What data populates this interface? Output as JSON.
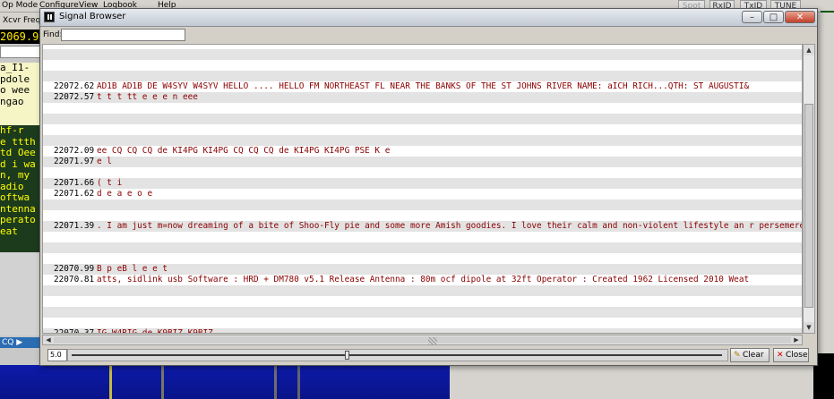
{
  "background": {
    "menus": [
      "Op Mode",
      "Configure",
      "View",
      "Logbook",
      "Help"
    ],
    "right_buttons": [
      "Spot",
      "RxID",
      "TxID",
      "TUNE"
    ],
    "xcvr_freq_label": "Xcvr Freq",
    "freq_display": "2069.9",
    "rx_text": [
      "a_I1-",
      " pdole",
      "o wee",
      " ngao",
      "",
      "hf-r",
      "e ttth",
      "td Oee",
      "d i wa",
      "n, my",
      "adio",
      "oftwa",
      "ntenna",
      "perato",
      "eat"
    ],
    "cq_label": "CQ ▶"
  },
  "window": {
    "title": "Signal Browser",
    "controls": [
      "–",
      "□",
      "✕"
    ]
  },
  "find": {
    "label": "Find:",
    "value": ""
  },
  "rows": [
    {
      "freq": "",
      "text": "",
      "shade": true
    },
    {
      "freq": "",
      "text": "",
      "shade": false
    },
    {
      "freq": "",
      "text": "",
      "shade": true
    },
    {
      "freq": "22072.62",
      "text": "AD1B AD1B DE W4SYV W4SYV HELLO ....  HELLO FM NORTHEAST FL NEAR THE BANKS OF  THE ST JOHNS RIVER  NAME: aICH RICH...QTH: ST AUGUSTI&",
      "shade": false
    },
    {
      "freq": "22072.57",
      "text": "t   t      t      tt e  e    e  n  eee",
      "shade": true
    },
    {
      "freq": "",
      "text": "",
      "shade": false
    },
    {
      "freq": "",
      "text": "",
      "shade": true
    },
    {
      "freq": "",
      "text": "",
      "shade": false
    },
    {
      "freq": "",
      "text": "",
      "shade": true
    },
    {
      "freq": "22072.09",
      "text": "ee CQ CQ CQ de KI4PG KI4PG CQ CQ CQ de KI4PG KI4PG PSE K  e",
      "shade": false
    },
    {
      "freq": "22071.97",
      "text": "e l",
      "shade": true
    },
    {
      "freq": "",
      "text": "",
      "shade": false
    },
    {
      "freq": "22071.66",
      "text": "( t i",
      "shade": true
    },
    {
      "freq": "22071.62",
      "text": "d e    a    e o e",
      "shade": false
    },
    {
      "freq": "",
      "text": "",
      "shade": true
    },
    {
      "freq": "",
      "text": "",
      "shade": false
    },
    {
      "freq": "22071.39",
      "text": ". I am just m=now dreaming of a bite of Shoo-Fly pie and some more Amish goodies. I love their calm and non-violent lifestyle an r persemere",
      "shade": true
    },
    {
      "freq": "",
      "text": "",
      "shade": false
    },
    {
      "freq": "",
      "text": "",
      "shade": true
    },
    {
      "freq": "",
      "text": "",
      "shade": false
    },
    {
      "freq": "22070.99",
      "text": "B p  eB   l e          e       t",
      "shade": true
    },
    {
      "freq": "22070.81",
      "text": "atts, sidlink usb    Software : HRD + DM780 v5.1 Release   Antenna  : 80m ocf dipole at 32ft   Operator : Created 1962  Licensed 2010   Weat",
      "shade": false
    },
    {
      "freq": "",
      "text": "",
      "shade": true
    },
    {
      "freq": "",
      "text": "",
      "shade": false
    },
    {
      "freq": "",
      "text": "",
      "shade": true
    },
    {
      "freq": "",
      "text": "",
      "shade": false
    },
    {
      "freq": "22070.37",
      "text": "IG W4RIG de K9BIZ K9BIZ",
      "shade": true
    }
  ],
  "bottom": {
    "level_value": "5.0",
    "slider_fraction": 0.42,
    "clear_label": "Clear",
    "close_label": "Close"
  }
}
